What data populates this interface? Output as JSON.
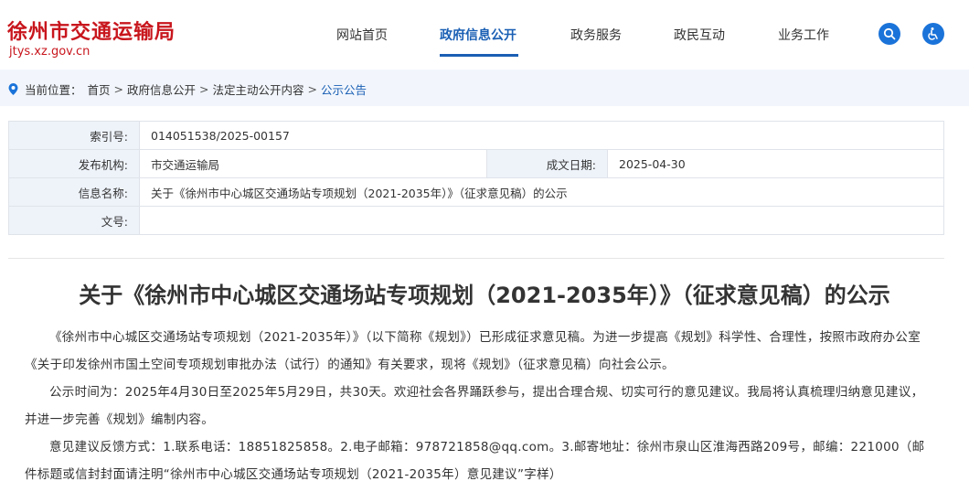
{
  "site": {
    "title": "徐州市交通运输局",
    "url": "jtys.xz.gov.cn"
  },
  "nav": {
    "items": [
      {
        "label": "网站首页"
      },
      {
        "label": "政府信息公开"
      },
      {
        "label": "政务服务"
      },
      {
        "label": "政民互动"
      },
      {
        "label": "业务工作"
      }
    ],
    "active": "政府信息公开"
  },
  "header_icons": [
    "search-icon",
    "accessibility-icon"
  ],
  "breadcrumb": {
    "prefix": "当前位置：",
    "items": [
      "首页",
      "政府信息公开",
      "法定主动公开内容"
    ],
    "separator": ">",
    "current": "公示公告"
  },
  "meta": {
    "index_label": "索引号:",
    "index_value": "014051538/2025-00157",
    "publisher_label": "发布机构:",
    "publisher_value": "市交通运输局",
    "date_label": "成文日期:",
    "date_value": "2025-04-30",
    "name_label": "信息名称:",
    "name_value": "关于《徐州市中心城区交通场站专项规划（2021-2035年）》（征求意见稿）的公示",
    "docno_label": "文号:",
    "docno_value": ""
  },
  "article": {
    "title": "关于《徐州市中心城区交通场站专项规划（2021-2035年）》（征求意见稿）的公示",
    "paragraphs": [
      "《徐州市中心城区交通场站专项规划（2021-2035年）》（以下简称《规划》）已形成征求意见稿。为进一步提高《规划》科学性、合理性，按照市政府办公室《关于印发徐州市国土空间专项规划审批办法（试行）的通知》有关要求，现将《规划》（征求意见稿）向社会公示。",
      "公示时间为：2025年4月30日至2025年5月29日，共30天。欢迎社会各界踊跃参与，提出合理合规、切实可行的意见建议。我局将认真梳理归纳意见建议，并进一步完善《规划》编制内容。",
      "意见建议反馈方式：1.联系电话：18851825858。2.电子邮箱：978721858@qq.com。3.邮寄地址：徐州市泉山区淮海西路209号，邮编：221000（邮件标题或信封封面请注明“徐州市中心城区交通场站专项规划（2021-2035年）意见建议”字样）"
    ]
  },
  "colors": {
    "brand": "#c8161d",
    "accent": "#1a5fb4",
    "icon_bg": "#1a73d9",
    "crumb_bg": "#f2f6fc",
    "label_bg": "#eef3fa"
  }
}
